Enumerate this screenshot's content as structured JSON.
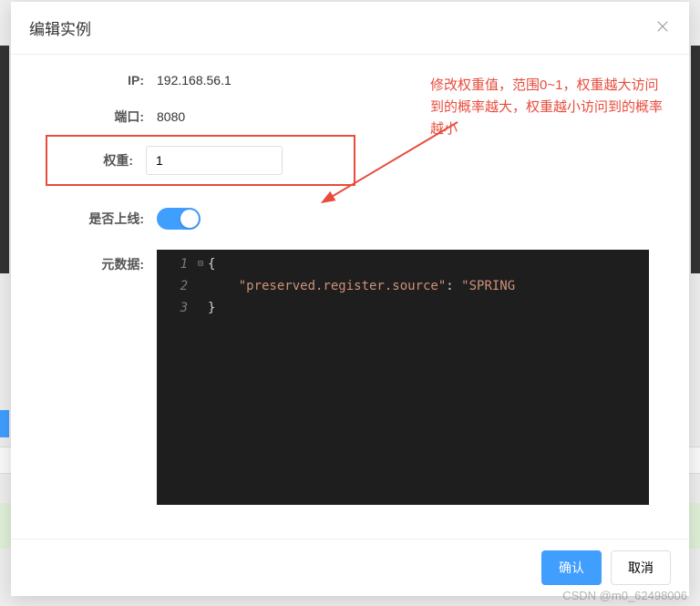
{
  "dialog": {
    "title": "编辑实例",
    "footer": {
      "confirm": "确认",
      "cancel": "取消"
    }
  },
  "form": {
    "ip": {
      "label": "IP:",
      "value": "192.168.56.1"
    },
    "port": {
      "label": "端口:",
      "value": "8080"
    },
    "weight": {
      "label": "权重:",
      "value": "1"
    },
    "online": {
      "label": "是否上线:",
      "state": "on"
    },
    "metadata": {
      "label": "元数据:",
      "lines": [
        {
          "num": "1",
          "text": "{"
        },
        {
          "num": "2",
          "key": "\"preserved.register.source\"",
          "colon": ": ",
          "val": "\"SPRING"
        },
        {
          "num": "3",
          "text": "}"
        }
      ]
    }
  },
  "annotation": {
    "text": "修改权重值，范围0~1，权重越大访问到的概率越大，权重越小访问到的概率越小",
    "color": "#e74c3c"
  },
  "watermark": "CSDN @m0_62498006"
}
